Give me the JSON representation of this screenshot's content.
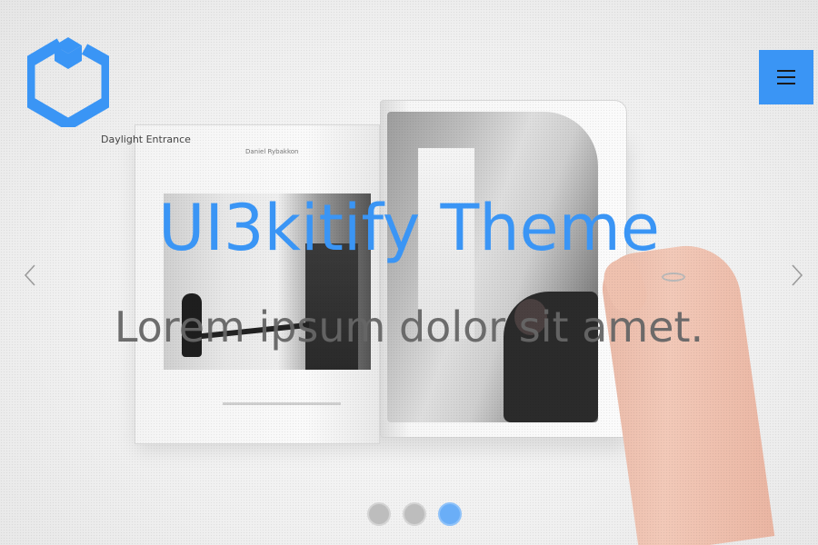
{
  "brand": {
    "logo_icon": "hexagon-logo-icon",
    "accent_color": "#3a95f5"
  },
  "menu": {
    "icon": "hamburger-icon"
  },
  "hero": {
    "title": "UI3kitify Theme",
    "subtitle": "Lorem ipsum dolor sit amet."
  },
  "magazine": {
    "title": "Daylight Entrance",
    "author": "Daniel Rybakkon"
  },
  "slider": {
    "prev_icon": "chevron-left-icon",
    "next_icon": "chevron-right-icon",
    "slide_count": 3,
    "active_slide": 3
  }
}
